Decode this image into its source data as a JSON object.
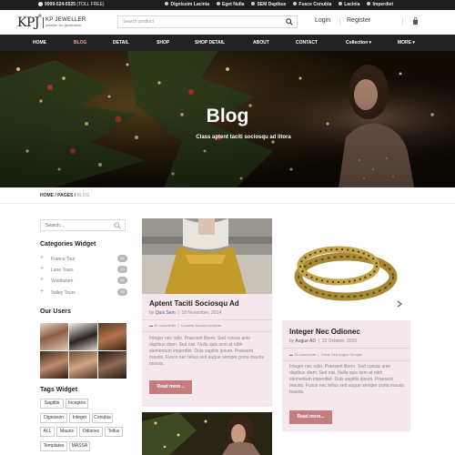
{
  "topbar": {
    "phone": "9999-524-5525",
    "phone_note": "(TOLL FREE)",
    "links": [
      "Dignissim Lacinia",
      "Eget Nulla",
      "SEM Dapibus",
      "Fusce Conubia",
      "Lacinia",
      "Imperdiet"
    ]
  },
  "header": {
    "logo_mark": "KPJ",
    "logo_reg": "®",
    "logo_name": "KP JEWELLER",
    "logo_tagline": "jeweller for generation",
    "search_placeholder": "Search product",
    "login": "Login",
    "register": "Register"
  },
  "nav": {
    "items": [
      "HOME",
      "BLOG",
      "DETAIL",
      "SHOP",
      "SHOP DETAIL",
      "ABOUT",
      "CONTACT",
      "Collection ▾",
      "MORE ▾"
    ],
    "active_index": 1
  },
  "hero": {
    "title": "Blog",
    "subtitle": "Class aptent taciti sociosqu ad litora"
  },
  "breadcrumb": {
    "home": "HOME",
    "sep1": "/",
    "pages": "PAGES",
    "sep2": "/",
    "current": "BLOG"
  },
  "sidebar": {
    "search_placeholder": "Search...",
    "categories_title": "Categories Widget",
    "categories": [
      {
        "label": "Franca Tour",
        "count": "16"
      },
      {
        "label": "Lane Tours",
        "count": "16"
      },
      {
        "label": "Vestibulum",
        "count": "16"
      },
      {
        "label": "Valley Tours",
        "count": "16"
      }
    ],
    "users_title": "Our Users",
    "tags_title": "Tags Widget",
    "tags": [
      "Sagittis",
      "Inceptos",
      "Dignissim",
      "Integer",
      "Conubia",
      "ALL",
      "Mauris",
      "Odionec",
      "Tellus",
      "Templates",
      "MASSA"
    ]
  },
  "posts": [
    {
      "title": "Aptent Taciti Sociosqu Ad",
      "by": "by",
      "author": "Quis Sem",
      "date": "18 November, 2014",
      "comments": "40 comments",
      "category": "Conubia Nostra Inceptos",
      "excerpt": "Integer nec odio. Praesent libero. Sed cursus ante dapibus diam. Sed nisi. Nulla quis sem at nibh elementum imperdiet. Duis sagittis ipsum. Praesent mauris. Fusce nec tellus sed augue semper porta mauris massa.",
      "button": "Read more..."
    },
    {
      "title": "Integer Nec Odionec",
      "by": "by",
      "author": "Augue AD",
      "date": "22 October, 2016",
      "comments": "34 comments",
      "category": "Tellus Sed Augue Semper",
      "excerpt": "Integer nec odio. Praesent libero. Sed cursus ante dapibus diam. Sed nisi. Nulla quis sem at nibh elementum imperdiet. Duis sagittis ipsum. Praesent mauris. Fusce nec tellus sed augue semper porta mauris massa.",
      "button": "Read more..."
    }
  ],
  "colors": {
    "accent": "#c47c81",
    "nav_bg": "#222222",
    "post_bg": "#f4e8ed"
  }
}
